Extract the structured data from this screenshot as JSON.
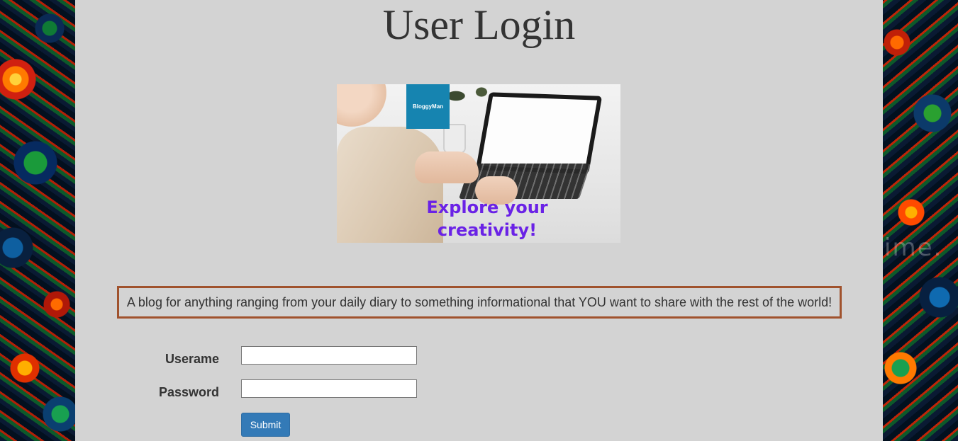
{
  "page": {
    "title": "User Login"
  },
  "hero": {
    "brand": "BloggyMan",
    "tagline": "Explore your creativity!"
  },
  "description": "A blog for anything ranging from your daily diary to something informational that YOU want to share with the rest of the world!",
  "form": {
    "username_label": "Userame",
    "username_value": "",
    "password_label": "Password",
    "password_value": "",
    "submit_label": "Submit"
  },
  "decor": {
    "watermark_text": "ime.",
    "accent_color": "#337ab7",
    "description_border_color": "#a0522d",
    "tagline_color": "#6a22e6",
    "brand_color": "#1684b0"
  }
}
